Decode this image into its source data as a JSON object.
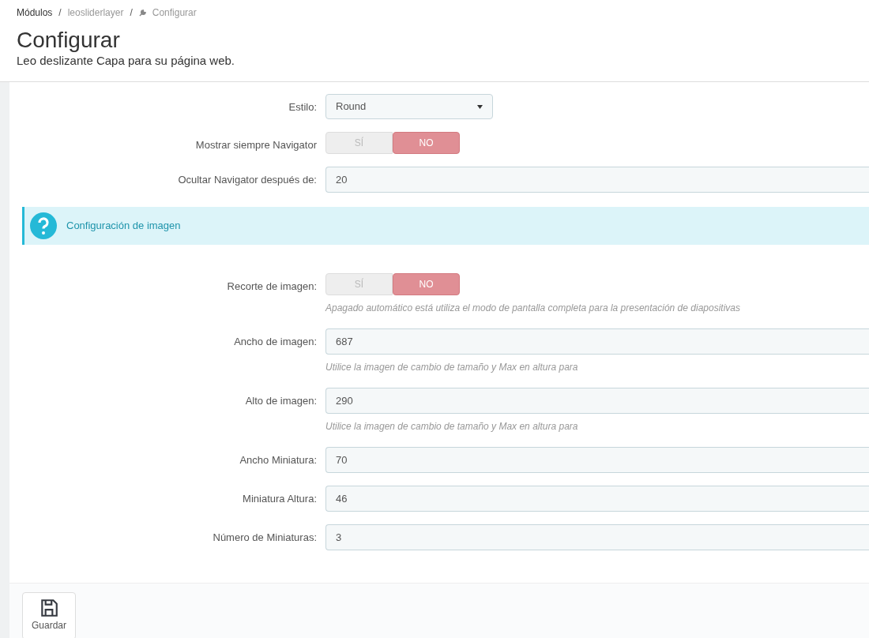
{
  "breadcrumb_separator": "/",
  "breadcrumb": [
    {
      "label": "Módulos",
      "kind": "link"
    },
    {
      "label": "leosliderlayer",
      "kind": "link"
    },
    {
      "label": "Configurar",
      "kind": "current"
    }
  ],
  "page": {
    "title": "Configurar",
    "subtitle": "Leo deslizante Capa para su página web."
  },
  "sections": [
    {
      "kind": "fields",
      "fields": [
        {
          "kind": "select",
          "label": "Estilo:",
          "value": "Round"
        },
        {
          "kind": "switch",
          "label": "Mostrar siempre Navigator",
          "options": [
            {
              "label": "SÍ",
              "selected": false
            },
            {
              "label": "NO",
              "selected": true
            }
          ]
        },
        {
          "kind": "text",
          "label": "Ocultar Navigator después de:",
          "value": "20"
        }
      ]
    },
    {
      "kind": "alert",
      "text": "Configuración de imagen"
    },
    {
      "kind": "fields",
      "fields": [
        {
          "kind": "switch",
          "label": "Recorte de imagen:",
          "options": [
            {
              "label": "SÍ",
              "selected": false
            },
            {
              "label": "NO",
              "selected": true
            }
          ],
          "help": "Apagado automático está utiliza el modo de pantalla completa para la presentación de diapositivas"
        },
        {
          "kind": "text",
          "label": "Ancho de imagen:",
          "value": "687",
          "help": "Utilice la imagen de cambio de tamaño y Max en altura para"
        },
        {
          "kind": "text",
          "label": "Alto de imagen:",
          "value": "290",
          "help": "Utilice la imagen de cambio de tamaño y Max en altura para"
        },
        {
          "kind": "text",
          "label": "Ancho Miniatura:",
          "value": "70"
        },
        {
          "kind": "text",
          "label": "Miniatura Altura:",
          "value": "46"
        },
        {
          "kind": "text",
          "label": "Número de Miniaturas:",
          "value": "3"
        }
      ]
    }
  ],
  "footer": {
    "save_button": "Guardar"
  }
}
